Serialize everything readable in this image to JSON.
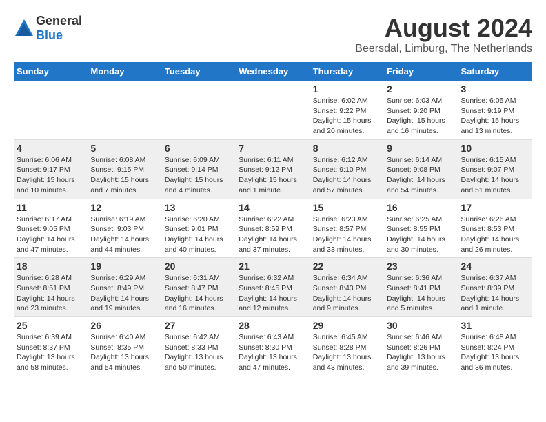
{
  "header": {
    "logo_general": "General",
    "logo_blue": "Blue",
    "title": "August 2024",
    "subtitle": "Beersdal, Limburg, The Netherlands"
  },
  "weekdays": [
    "Sunday",
    "Monday",
    "Tuesday",
    "Wednesday",
    "Thursday",
    "Friday",
    "Saturday"
  ],
  "weeks": [
    {
      "group": "row-group-1",
      "days": [
        {
          "num": "",
          "info": ""
        },
        {
          "num": "",
          "info": ""
        },
        {
          "num": "",
          "info": ""
        },
        {
          "num": "",
          "info": ""
        },
        {
          "num": "1",
          "info": "Sunrise: 6:02 AM\nSunset: 9:22 PM\nDaylight: 15 hours\nand 20 minutes."
        },
        {
          "num": "2",
          "info": "Sunrise: 6:03 AM\nSunset: 9:20 PM\nDaylight: 15 hours\nand 16 minutes."
        },
        {
          "num": "3",
          "info": "Sunrise: 6:05 AM\nSunset: 9:19 PM\nDaylight: 15 hours\nand 13 minutes."
        }
      ]
    },
    {
      "group": "row-group-2",
      "days": [
        {
          "num": "4",
          "info": "Sunrise: 6:06 AM\nSunset: 9:17 PM\nDaylight: 15 hours\nand 10 minutes."
        },
        {
          "num": "5",
          "info": "Sunrise: 6:08 AM\nSunset: 9:15 PM\nDaylight: 15 hours\nand 7 minutes."
        },
        {
          "num": "6",
          "info": "Sunrise: 6:09 AM\nSunset: 9:14 PM\nDaylight: 15 hours\nand 4 minutes."
        },
        {
          "num": "7",
          "info": "Sunrise: 6:11 AM\nSunset: 9:12 PM\nDaylight: 15 hours\nand 1 minute."
        },
        {
          "num": "8",
          "info": "Sunrise: 6:12 AM\nSunset: 9:10 PM\nDaylight: 14 hours\nand 57 minutes."
        },
        {
          "num": "9",
          "info": "Sunrise: 6:14 AM\nSunset: 9:08 PM\nDaylight: 14 hours\nand 54 minutes."
        },
        {
          "num": "10",
          "info": "Sunrise: 6:15 AM\nSunset: 9:07 PM\nDaylight: 14 hours\nand 51 minutes."
        }
      ]
    },
    {
      "group": "row-group-3",
      "days": [
        {
          "num": "11",
          "info": "Sunrise: 6:17 AM\nSunset: 9:05 PM\nDaylight: 14 hours\nand 47 minutes."
        },
        {
          "num": "12",
          "info": "Sunrise: 6:19 AM\nSunset: 9:03 PM\nDaylight: 14 hours\nand 44 minutes."
        },
        {
          "num": "13",
          "info": "Sunrise: 6:20 AM\nSunset: 9:01 PM\nDaylight: 14 hours\nand 40 minutes."
        },
        {
          "num": "14",
          "info": "Sunrise: 6:22 AM\nSunset: 8:59 PM\nDaylight: 14 hours\nand 37 minutes."
        },
        {
          "num": "15",
          "info": "Sunrise: 6:23 AM\nSunset: 8:57 PM\nDaylight: 14 hours\nand 33 minutes."
        },
        {
          "num": "16",
          "info": "Sunrise: 6:25 AM\nSunset: 8:55 PM\nDaylight: 14 hours\nand 30 minutes."
        },
        {
          "num": "17",
          "info": "Sunrise: 6:26 AM\nSunset: 8:53 PM\nDaylight: 14 hours\nand 26 minutes."
        }
      ]
    },
    {
      "group": "row-group-4",
      "days": [
        {
          "num": "18",
          "info": "Sunrise: 6:28 AM\nSunset: 8:51 PM\nDaylight: 14 hours\nand 23 minutes."
        },
        {
          "num": "19",
          "info": "Sunrise: 6:29 AM\nSunset: 8:49 PM\nDaylight: 14 hours\nand 19 minutes."
        },
        {
          "num": "20",
          "info": "Sunrise: 6:31 AM\nSunset: 8:47 PM\nDaylight: 14 hours\nand 16 minutes."
        },
        {
          "num": "21",
          "info": "Sunrise: 6:32 AM\nSunset: 8:45 PM\nDaylight: 14 hours\nand 12 minutes."
        },
        {
          "num": "22",
          "info": "Sunrise: 6:34 AM\nSunset: 8:43 PM\nDaylight: 14 hours\nand 9 minutes."
        },
        {
          "num": "23",
          "info": "Sunrise: 6:36 AM\nSunset: 8:41 PM\nDaylight: 14 hours\nand 5 minutes."
        },
        {
          "num": "24",
          "info": "Sunrise: 6:37 AM\nSunset: 8:39 PM\nDaylight: 14 hours\nand 1 minute."
        }
      ]
    },
    {
      "group": "row-group-5",
      "days": [
        {
          "num": "25",
          "info": "Sunrise: 6:39 AM\nSunset: 8:37 PM\nDaylight: 13 hours\nand 58 minutes."
        },
        {
          "num": "26",
          "info": "Sunrise: 6:40 AM\nSunset: 8:35 PM\nDaylight: 13 hours\nand 54 minutes."
        },
        {
          "num": "27",
          "info": "Sunrise: 6:42 AM\nSunset: 8:33 PM\nDaylight: 13 hours\nand 50 minutes."
        },
        {
          "num": "28",
          "info": "Sunrise: 6:43 AM\nSunset: 8:30 PM\nDaylight: 13 hours\nand 47 minutes."
        },
        {
          "num": "29",
          "info": "Sunrise: 6:45 AM\nSunset: 8:28 PM\nDaylight: 13 hours\nand 43 minutes."
        },
        {
          "num": "30",
          "info": "Sunrise: 6:46 AM\nSunset: 8:26 PM\nDaylight: 13 hours\nand 39 minutes."
        },
        {
          "num": "31",
          "info": "Sunrise: 6:48 AM\nSunset: 8:24 PM\nDaylight: 13 hours\nand 36 minutes."
        }
      ]
    }
  ]
}
